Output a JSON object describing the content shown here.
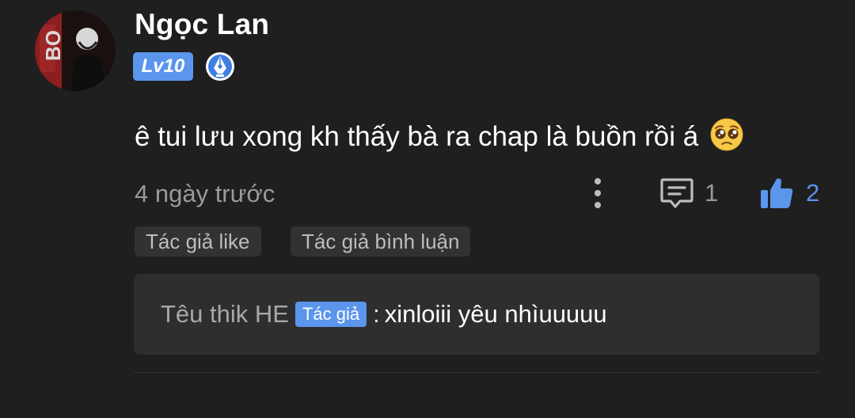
{
  "comment": {
    "username": "Ngọc Lan",
    "level": "Lv10",
    "text": "ê tui lưu xong kh thấy bà ra chap là buồn rồi á",
    "emoji": "pleading-face-emoji",
    "time": "4 ngày trước",
    "reply_count": "1",
    "like_count": "2",
    "tags": [
      "Tác giả like",
      "Tác giả bình luận"
    ],
    "reply": {
      "author": "Têu thik HE",
      "author_label": "Tác giả",
      "separator": ":",
      "text": "xinloiii yêu nhìuuuuu"
    }
  },
  "icons": {
    "more": "more-vertical-icon",
    "reply": "comment-icon",
    "like": "thumbs-up-icon",
    "author_badge": "pen-nib-badge-icon"
  },
  "colors": {
    "background": "#1f1f1f",
    "accent": "#5b95ec",
    "muted_text": "#9a9a9a",
    "tag_background": "#323232",
    "reply_background": "#2e2e2e"
  }
}
